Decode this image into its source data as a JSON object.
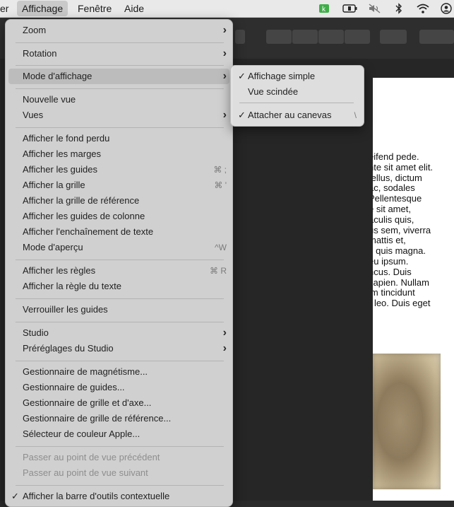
{
  "menubar": {
    "items": [
      "er",
      "Affichage",
      "Fenêtre",
      "Aide"
    ],
    "status_icons": [
      "app-k-icon",
      "battery-plug-icon",
      "mute-icon",
      "bluetooth-icon",
      "wifi-icon",
      "user-icon"
    ]
  },
  "menu": {
    "zoom": "Zoom",
    "rotation": "Rotation",
    "mode_affichage": "Mode d'affichage",
    "nouvelle_vue": "Nouvelle vue",
    "vues": "Vues",
    "fond_perdu": "Afficher le fond perdu",
    "marges": "Afficher les marges",
    "guides": "Afficher les guides",
    "guides_sc": "⌘ ;",
    "grille": "Afficher la grille",
    "grille_sc": "⌘ '",
    "grille_ref": "Afficher la grille de référence",
    "guides_colonne": "Afficher les guides de colonne",
    "enchainement": "Afficher l'enchaînement de texte",
    "apercu": "Mode d'aperçu",
    "apercu_sc": "^W",
    "regles": "Afficher les règles",
    "regles_sc": "⌘ R",
    "regle_texte": "Afficher la règle du texte",
    "verrouiller": "Verrouiller les guides",
    "studio": "Studio",
    "preglages": "Préréglages du Studio",
    "magnetisme": "Gestionnaire de magnétisme...",
    "gest_guides": "Gestionnaire de guides...",
    "gest_grille_axe": "Gestionnaire de grille et d'axe...",
    "gest_grille_ref": "Gestionnaire de grille de référence...",
    "couleur_apple": "Sélecteur de couleur Apple...",
    "pt_vue_prec": "Passer au point de vue précédent",
    "pt_vue_suiv": "Passer au point de vue suivant",
    "barre_contextuelle": "Afficher la barre d'outils contextuelle"
  },
  "submenu": {
    "affichage_simple": "Affichage simple",
    "vue_scindee": "Vue scindée",
    "attacher": "Attacher au canevas",
    "attacher_sc": "\\"
  },
  "page_text": [
    "eifend pede.",
    "nte sit amet elit.",
    "tellus, dictum",
    "ac, sodales",
    "Pellentesque",
    "e sit amet,",
    "aculis quis,",
    "us sem, viverra",
    " mattis et,",
    "s quis magna.",
    "eu ipsum.",
    "ncus. Duis",
    "sapien. Nullam",
    "im tincidunt",
    "r leo. Duis eget"
  ],
  "colors": {
    "menu_bg": "#d6d6d6",
    "highlight": "#bcbcbc",
    "app_bg": "#262626",
    "status_green": "#3fae49"
  }
}
